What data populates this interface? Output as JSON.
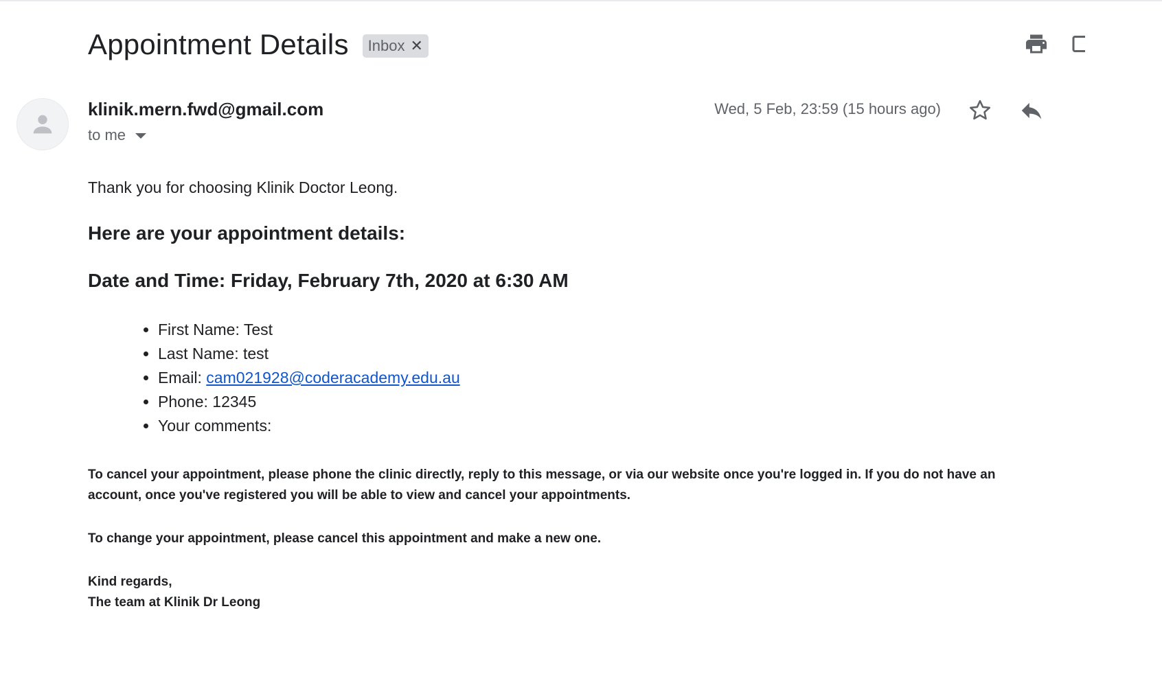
{
  "email": {
    "subject": "Appointment Details",
    "label": "Inbox",
    "sender": "klinik.mern.fwd@gmail.com",
    "recipient": "to me",
    "date": "Wed, 5 Feb, 23:59 (15 hours ago)"
  },
  "icons": {
    "print": "print-icon",
    "new_window": "open-in-new-window-icon",
    "avatar": "person-icon",
    "star": "star-icon",
    "reply": "reply-icon",
    "label_remove": "close-icon",
    "recipient_details": "chevron-down-icon"
  },
  "body": {
    "greeting": "Thank you for choosing Klinik Doctor Leong.",
    "heading": "Here are your appointment details:",
    "datetime": "Date and Time: Friday, February 7th, 2020 at 6:30 AM",
    "details": {
      "first_name": "First Name: Test",
      "last_name": "Last Name: test",
      "email_label": "Email: ",
      "email_value": "cam021928@coderacademy.edu.au",
      "phone": "Phone: 12345",
      "comments": "Your comments:"
    },
    "cancel_note": "To cancel your appointment, please phone the clinic directly, reply to this message, or via our website once you're logged in. If you do not have an account, once you've registered you will be able to view and cancel your appointments.",
    "change_note": "To change your appointment, please cancel this appointment and make a new one.",
    "signoff": "Kind regards,",
    "signature": "The team at Klinik Dr Leong"
  },
  "colors": {
    "link": "#1155cc",
    "chip_bg": "#dadce0",
    "muted_text": "#5f6368",
    "text": "#202124"
  }
}
